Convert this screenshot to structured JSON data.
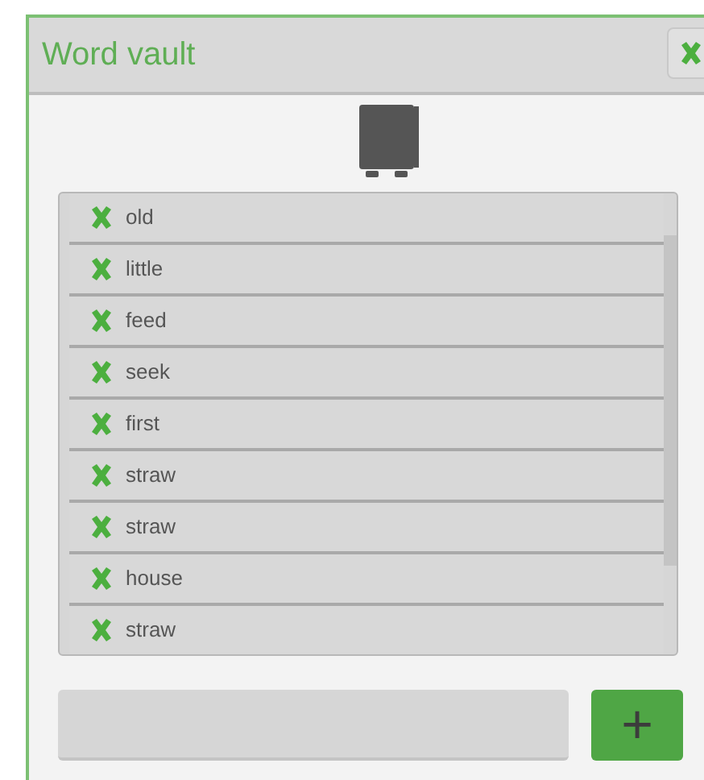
{
  "window": {
    "title": "Word vault"
  },
  "words": [
    {
      "text": "old"
    },
    {
      "text": "little"
    },
    {
      "text": "feed"
    },
    {
      "text": "seek"
    },
    {
      "text": "first"
    },
    {
      "text": "straw"
    },
    {
      "text": "straw"
    },
    {
      "text": "house"
    },
    {
      "text": "straw"
    }
  ],
  "add_button": {
    "label": "+"
  }
}
